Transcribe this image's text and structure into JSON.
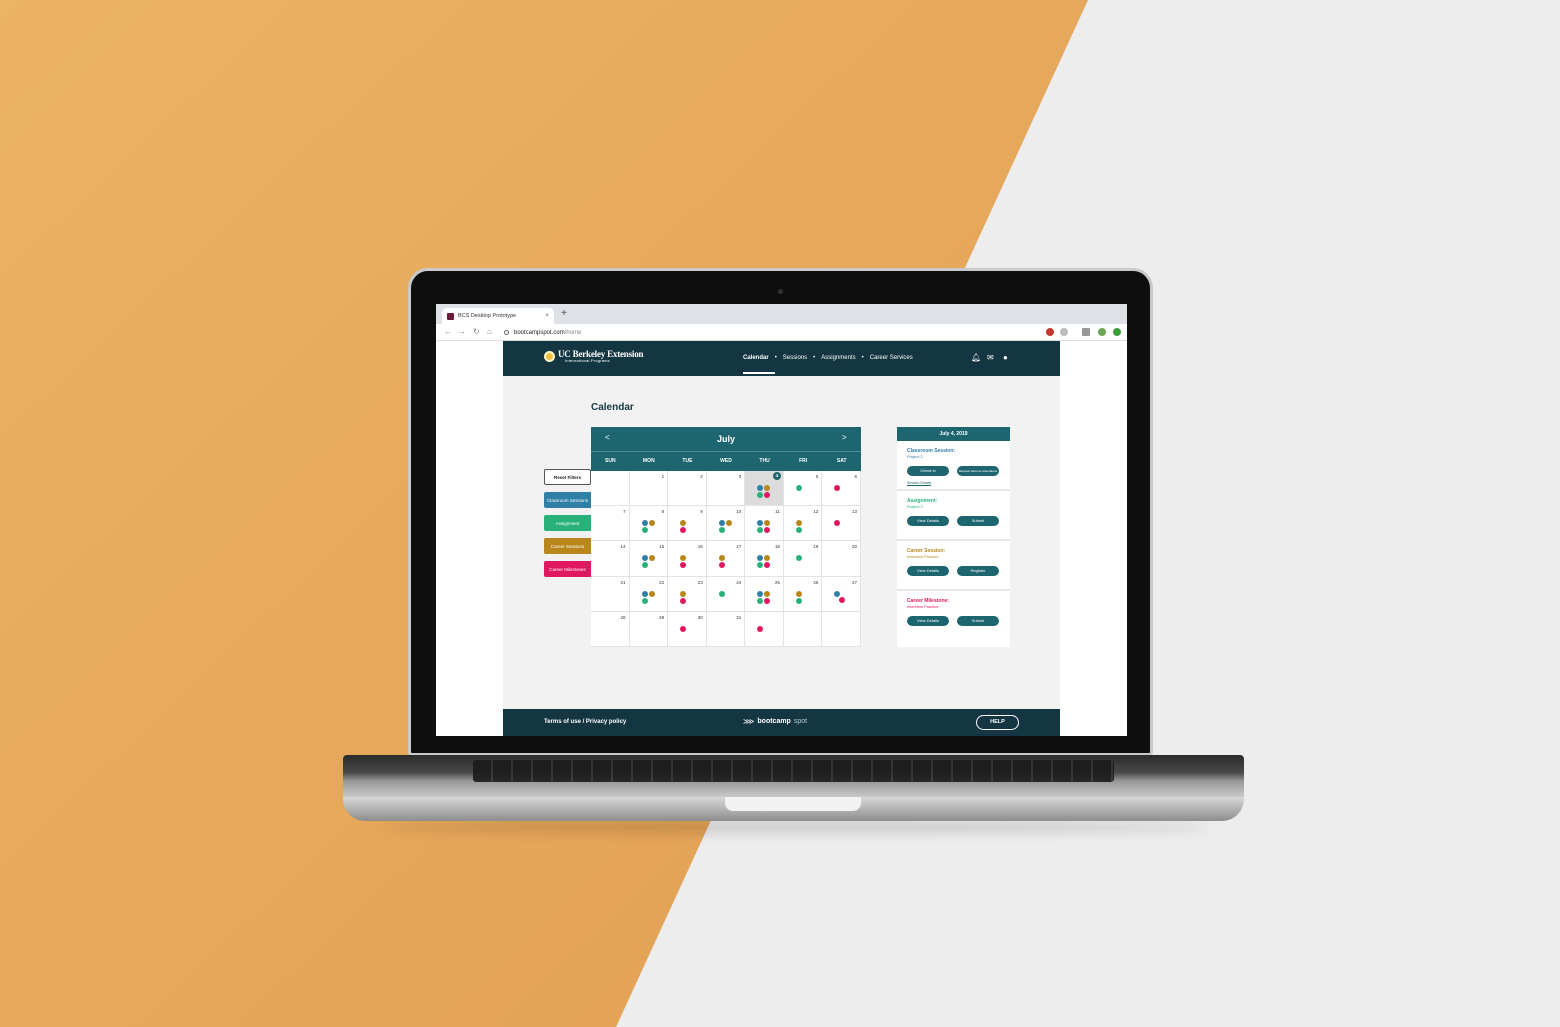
{
  "colors": {
    "backdrop_orange": "#e7a85a",
    "backdrop_light": "#ececec",
    "nav_dark": "#143642",
    "teal": "#1d6670",
    "classroom": "#2f7fa7",
    "assignment": "#28b27a",
    "career": "#b8861b",
    "milestone": "#e0185f"
  },
  "browser": {
    "tab_title": "BCS Desktop Prototype",
    "tab_close": "×",
    "new_tab": "+",
    "url_host": "bootcampspot.com",
    "url_path": "/home",
    "nav_icons": [
      "back-icon",
      "forward-icon",
      "reload-icon",
      "home-icon"
    ]
  },
  "header": {
    "logo_title": "UC Berkeley Extension",
    "logo_subtitle": "International Programs",
    "nav": [
      "Calendar",
      "Sessions",
      "Assignments",
      "Career Services"
    ],
    "nav_sep": "•",
    "icons": [
      "bell-icon",
      "mail-icon",
      "user-icon"
    ]
  },
  "page_title": "Calendar",
  "filters": {
    "reset": "Reset Filters",
    "items": [
      "Classroom Sessions",
      "Assignment",
      "Career Sessions",
      "Career Milestones"
    ]
  },
  "calendar": {
    "month": "July",
    "prev": "<",
    "next": ">",
    "day_names": [
      "SUN",
      "MON",
      "TUE",
      "WED",
      "THU",
      "FRI",
      "SAT"
    ],
    "today": "4",
    "days": [
      "",
      "1",
      "2",
      "3",
      "4",
      "5",
      "6",
      "7",
      "8",
      "9",
      "10",
      "11",
      "12",
      "13",
      "14",
      "15",
      "16",
      "17",
      "18",
      "19",
      "20",
      "21",
      "22",
      "23",
      "24",
      "25",
      "26",
      "27",
      "28",
      "29",
      "30",
      "31",
      "",
      "",
      ""
    ]
  },
  "sidepanel": {
    "date": "July 4, 2019",
    "classroom": {
      "title": "Classroom Session:",
      "sub": "Project 2",
      "btn1": "Check in",
      "btn2": "Request Remote Attendance",
      "link": "Session Details"
    },
    "assignment": {
      "title": "Assignment:",
      "sub": "Project 2",
      "btn1": "View Details",
      "btn2": "Submit"
    },
    "career_session": {
      "title": "Career Session:",
      "sub": "Interview Practice",
      "btn1": "View Details",
      "btn2": "Register"
    },
    "career_milestone": {
      "title": "Career Milestone:",
      "sub": "Interview Practice",
      "btn1": "View Details",
      "btn2": "Submit"
    }
  },
  "footer": {
    "links": "Terms of use / Privacy policy",
    "brand_bold": "bootcamp",
    "brand_light": "spot",
    "help": "HELP"
  }
}
